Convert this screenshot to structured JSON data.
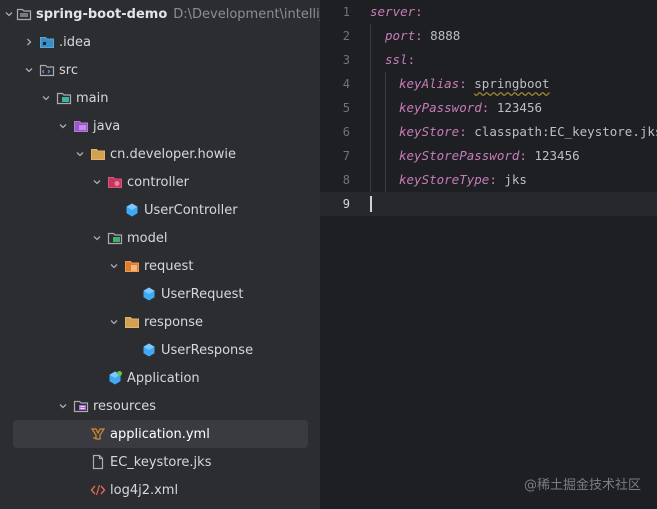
{
  "project": {
    "root_name": "spring-boot-demo",
    "root_path": "D:\\Development\\intellij_work",
    "items": [
      {
        "label": "spring-boot-demo",
        "level": 0,
        "chevron": "down",
        "icon": "module-folder-icon"
      },
      {
        "label": ".idea",
        "level": 1,
        "chevron": "right",
        "icon": "folder-icon"
      },
      {
        "label": "src",
        "level": 1,
        "chevron": "down",
        "icon": "source-folder-icon"
      },
      {
        "label": "main",
        "level": 2,
        "chevron": "down",
        "icon": "folder-icon"
      },
      {
        "label": "java",
        "level": 3,
        "chevron": "down",
        "icon": "java-source-root-icon"
      },
      {
        "label": "cn.developer.howie",
        "level": 4,
        "chevron": "down",
        "icon": "package-icon"
      },
      {
        "label": "controller",
        "level": 5,
        "chevron": "down",
        "icon": "controller-package-icon"
      },
      {
        "label": "UserController",
        "level": 6,
        "chevron": "none",
        "icon": "class-icon"
      },
      {
        "label": "model",
        "level": 5,
        "chevron": "down",
        "icon": "model-package-icon"
      },
      {
        "label": "request",
        "level": 6,
        "chevron": "down",
        "icon": "request-package-icon"
      },
      {
        "label": "UserRequest",
        "level": 7,
        "chevron": "none",
        "icon": "class-icon"
      },
      {
        "label": "response",
        "level": 6,
        "chevron": "down",
        "icon": "response-package-icon"
      },
      {
        "label": "UserResponse",
        "level": 7,
        "chevron": "none",
        "icon": "class-icon"
      },
      {
        "label": "Application",
        "level": 5,
        "chevron": "none",
        "icon": "spring-app-icon"
      },
      {
        "label": "resources",
        "level": 3,
        "chevron": "down",
        "icon": "resources-folder-icon"
      },
      {
        "label": "application.yml",
        "level": 4,
        "chevron": "none",
        "icon": "yaml-file-icon",
        "selected": true
      },
      {
        "label": "EC_keystore.jks",
        "level": 4,
        "chevron": "none",
        "icon": "file-icon"
      },
      {
        "label": "log4j2.xml",
        "level": 4,
        "chevron": "none",
        "icon": "xml-file-icon"
      }
    ]
  },
  "editor": {
    "current_line": 9,
    "lines": [
      {
        "n": "1",
        "key": "server",
        "value": ""
      },
      {
        "n": "2",
        "key": "port",
        "value": "8888"
      },
      {
        "n": "3",
        "key": "ssl",
        "value": ""
      },
      {
        "n": "4",
        "key": "keyAlias",
        "value": "springboot"
      },
      {
        "n": "5",
        "key": "keyPassword",
        "value": "123456"
      },
      {
        "n": "6",
        "key": "keyStore",
        "value": "classpath:EC_keystore.jks"
      },
      {
        "n": "7",
        "key": "keyStorePassword",
        "value": "123456"
      },
      {
        "n": "8",
        "key": "keyStoreType",
        "value": "jks"
      },
      {
        "n": "9",
        "key": "",
        "value": ""
      }
    ]
  },
  "watermark": "@稀土掘金技术社区",
  "colors": {
    "tree_bg": "#2b2d30",
    "editor_bg": "#1e1f22",
    "yaml_key": "#c77dbb",
    "folder": "#d3a152",
    "class": "#3fa9f5"
  }
}
